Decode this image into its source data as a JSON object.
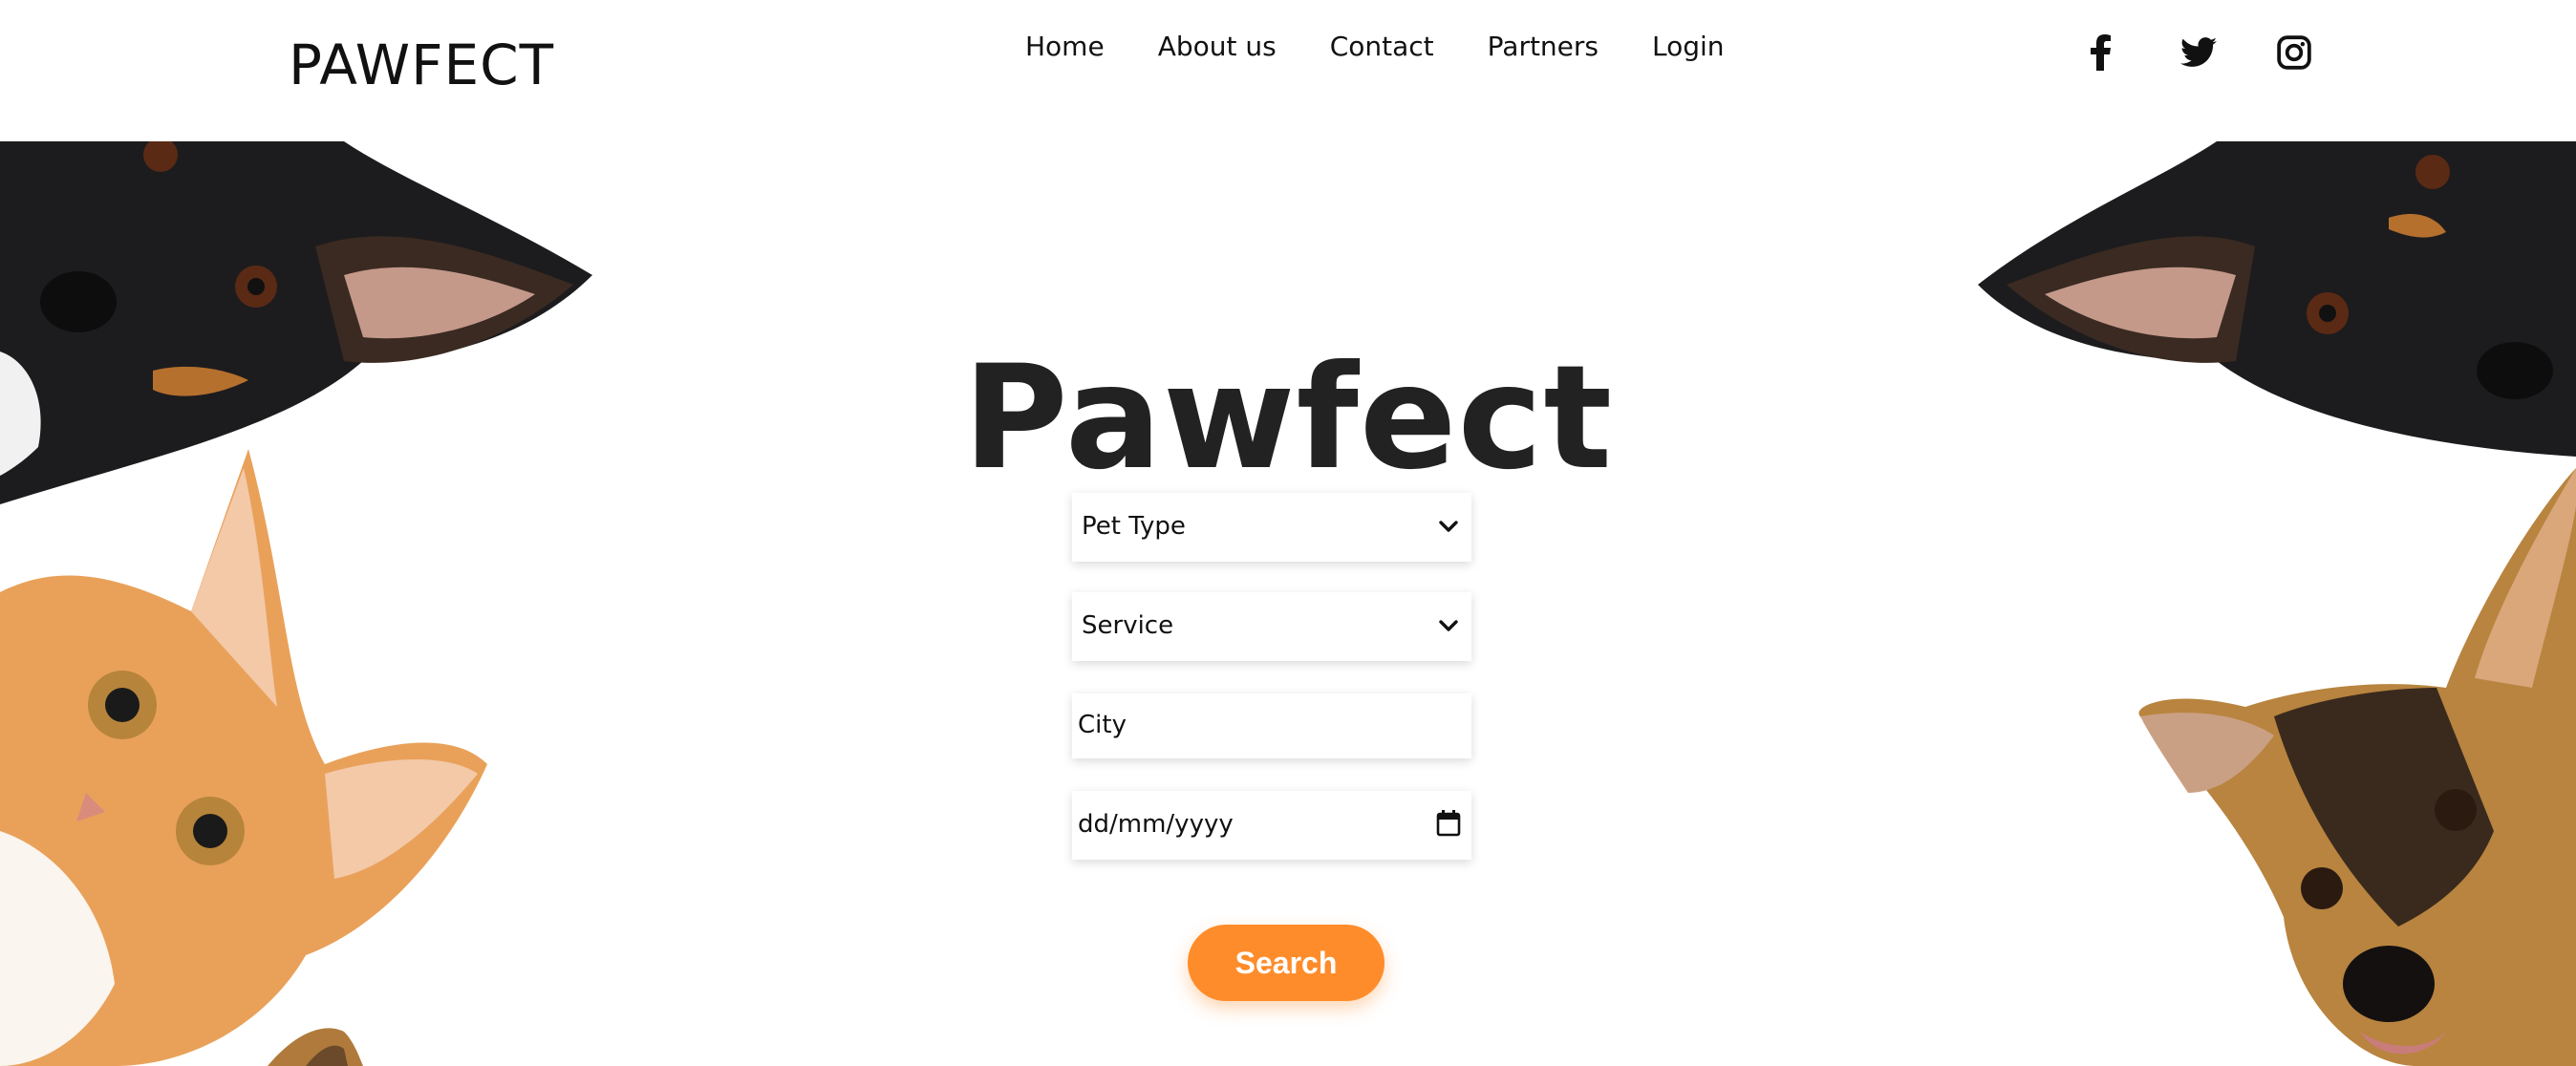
{
  "header": {
    "brand": "PAWFECT",
    "nav": [
      "Home",
      "About us",
      "Contact",
      "Partners",
      "Login"
    ],
    "social": [
      "facebook-icon",
      "twitter-icon",
      "instagram-icon"
    ]
  },
  "hero": {
    "title": "Pawfect"
  },
  "form": {
    "pet_type": "Pet Type",
    "service": "Service",
    "city_placeholder": "City",
    "date_placeholder": "dd/mm/yyyy",
    "search_label": "Search"
  },
  "colors": {
    "accent": "#ff8c2b",
    "text": "#1e1e1e",
    "background": "#ffffff"
  }
}
